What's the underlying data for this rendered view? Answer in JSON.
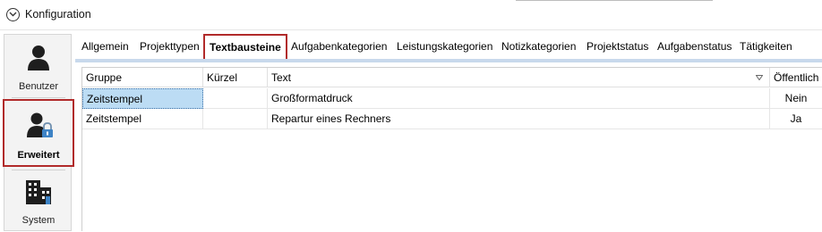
{
  "window": {
    "title": "Konfiguration"
  },
  "sidebar": {
    "items": [
      {
        "label": "Benutzer",
        "icon": "user-icon"
      },
      {
        "label": "Erweitert",
        "icon": "user-lock-icon",
        "active": true
      },
      {
        "label": "System",
        "icon": "building-icon"
      }
    ]
  },
  "tabs": [
    {
      "label": "Allgemein"
    },
    {
      "label": "Projekttypen"
    },
    {
      "label": "Textbausteine",
      "active": true
    },
    {
      "label": "Aufgabenkategorien"
    },
    {
      "label": "Leistungskategorien"
    },
    {
      "label": "Notizkategorien"
    },
    {
      "label": "Projektstatus"
    },
    {
      "label": "Aufgabenstatus"
    },
    {
      "label": "Tätigkeiten"
    }
  ],
  "grid": {
    "columns": [
      "Gruppe",
      "Kürzel",
      "Text",
      "Öffentlich"
    ],
    "rows": [
      {
        "gruppe": "Zeitstempel",
        "kuerzel": "",
        "text": "Großformatdruck",
        "oeffentlich": "Nein",
        "selected": true
      },
      {
        "gruppe": "Zeitstempel",
        "kuerzel": "",
        "text": "Repartur eines Rechners",
        "oeffentlich": "Ja"
      }
    ]
  },
  "colors": {
    "accent_highlight": "#b12a2a",
    "tab_underline": "#c8d9ec",
    "selection": "#bcdcf4"
  }
}
